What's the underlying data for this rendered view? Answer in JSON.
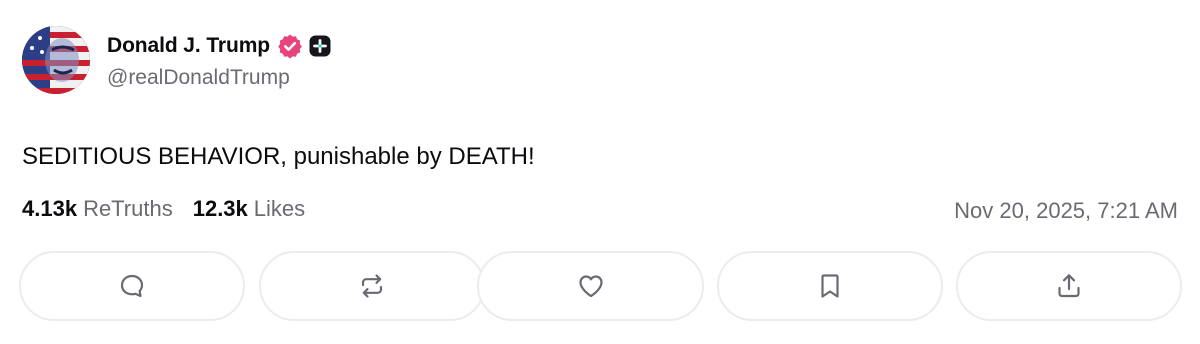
{
  "author": {
    "display_name": "Donald J. Trump",
    "handle": "@realDonaldTrump",
    "verified_badge_color": "#e8437a",
    "plus_badge_color": "#15151c"
  },
  "post": {
    "text": "SEDITIOUS BEHAVIOR, punishable by DEATH!",
    "retruths_count": "4.13k",
    "retruths_label": "ReTruths",
    "likes_count": "12.3k",
    "likes_label": "Likes",
    "timestamp": "Nov 20, 2025, 7:21 AM"
  },
  "actions": [
    {
      "name": "reply",
      "icon": "reply-bubble-icon"
    },
    {
      "name": "retruth",
      "icon": "retruth-arrows-icon"
    },
    {
      "name": "like",
      "icon": "heart-icon"
    },
    {
      "name": "bookmark",
      "icon": "bookmark-icon"
    },
    {
      "name": "share",
      "icon": "share-upload-icon"
    }
  ],
  "colors": {
    "text_primary": "#0b0b10",
    "text_secondary": "#6a6a74",
    "button_border": "#ececf0",
    "icon": "#6a6a74"
  }
}
